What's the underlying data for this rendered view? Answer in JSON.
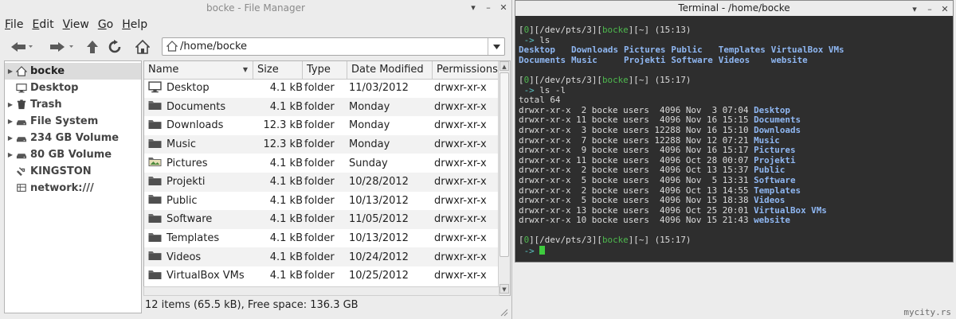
{
  "file_manager": {
    "title": "bocke - File Manager",
    "menu": [
      {
        "acc": "F",
        "rest": "ile"
      },
      {
        "acc": "E",
        "rest": "dit"
      },
      {
        "acc": "V",
        "rest": "iew"
      },
      {
        "acc": "G",
        "rest": "o"
      },
      {
        "acc": "H",
        "rest": "elp"
      }
    ],
    "toolbar_icons": [
      "back-arrow-icon",
      "forward-arrow-icon",
      "up-arrow-icon",
      "reload-icon",
      "home-icon"
    ],
    "address": "/home/bocke",
    "sidebar": [
      {
        "label": "bocke",
        "icon": "home-icon",
        "expander": true,
        "selected": true
      },
      {
        "label": "Desktop",
        "icon": "monitor-icon",
        "expander": false,
        "selected": false
      },
      {
        "label": "Trash",
        "icon": "trash-icon",
        "expander": true,
        "selected": false
      },
      {
        "label": "File System",
        "icon": "drive-icon",
        "expander": true,
        "selected": false
      },
      {
        "label": "234 GB Volume",
        "icon": "drive-icon",
        "expander": true,
        "selected": false
      },
      {
        "label": "80 GB Volume",
        "icon": "drive-icon",
        "expander": true,
        "selected": false
      },
      {
        "label": "KINGSTON",
        "icon": "usb-icon",
        "expander": false,
        "selected": false
      },
      {
        "label": "network:///",
        "icon": "network-icon",
        "expander": false,
        "selected": false
      }
    ],
    "columns": [
      "Name",
      "Size",
      "Type",
      "Date Modified",
      "Permissions"
    ],
    "files": [
      {
        "name": "Desktop",
        "size": "4.1 kB",
        "type": "folder",
        "date": "11/03/2012",
        "perm": "drwxr-xr-x",
        "icon": "monitor-icon"
      },
      {
        "name": "Documents",
        "size": "4.1 kB",
        "type": "folder",
        "date": "Monday",
        "perm": "drwxr-xr-x",
        "icon": "folder-icon"
      },
      {
        "name": "Downloads",
        "size": "12.3 kB",
        "type": "folder",
        "date": "Monday",
        "perm": "drwxr-xr-x",
        "icon": "folder-icon"
      },
      {
        "name": "Music",
        "size": "12.3 kB",
        "type": "folder",
        "date": "Monday",
        "perm": "drwxr-xr-x",
        "icon": "folder-icon"
      },
      {
        "name": "Pictures",
        "size": "4.1 kB",
        "type": "folder",
        "date": "Sunday",
        "perm": "drwxr-xr-x",
        "icon": "pictures-icon"
      },
      {
        "name": "Projekti",
        "size": "4.1 kB",
        "type": "folder",
        "date": "10/28/2012",
        "perm": "drwxr-xr-x",
        "icon": "folder-icon"
      },
      {
        "name": "Public",
        "size": "4.1 kB",
        "type": "folder",
        "date": "10/13/2012",
        "perm": "drwxr-xr-x",
        "icon": "folder-icon"
      },
      {
        "name": "Software",
        "size": "4.1 kB",
        "type": "folder",
        "date": "11/05/2012",
        "perm": "drwxr-xr-x",
        "icon": "folder-icon"
      },
      {
        "name": "Templates",
        "size": "4.1 kB",
        "type": "folder",
        "date": "10/13/2012",
        "perm": "drwxr-xr-x",
        "icon": "folder-icon"
      },
      {
        "name": "Videos",
        "size": "4.1 kB",
        "type": "folder",
        "date": "10/24/2012",
        "perm": "drwxr-xr-x",
        "icon": "folder-icon"
      },
      {
        "name": "VirtualBox VMs",
        "size": "4.1 kB",
        "type": "folder",
        "date": "10/25/2012",
        "perm": "drwxr-xr-x",
        "icon": "folder-icon"
      }
    ],
    "status": "12 items (65.5 kB), Free space: 136.3 GB"
  },
  "terminal": {
    "title": "Terminal - /home/bocke",
    "prompt": {
      "code": "0",
      "tty": "/dev/pts/3",
      "user": "bocke",
      "dir": "~",
      "arrow": "->"
    },
    "blocks": [
      {
        "time": "(15:13)",
        "cmd": "ls",
        "ls_rows": [
          [
            "Desktop",
            "Downloads",
            "Pictures",
            "Public",
            "Templates",
            "VirtualBox VMs"
          ],
          [
            "Documents",
            "Music",
            "Projekti",
            "Software",
            "Videos",
            "website"
          ]
        ]
      },
      {
        "time": "(15:17)",
        "cmd": "ls -l",
        "total": "total 64",
        "entries": [
          {
            "meta": "drwxr-xr-x  2 bocke users  4096 Nov  3 07:04",
            "name": "Desktop"
          },
          {
            "meta": "drwxr-xr-x 11 bocke users  4096 Nov 16 15:15",
            "name": "Documents"
          },
          {
            "meta": "drwxr-xr-x  3 bocke users 12288 Nov 16 15:10",
            "name": "Downloads"
          },
          {
            "meta": "drwxr-xr-x  7 bocke users 12288 Nov 12 07:21",
            "name": "Music"
          },
          {
            "meta": "drwxr-xr-x  9 bocke users  4096 Nov 16 15:17",
            "name": "Pictures"
          },
          {
            "meta": "drwxr-xr-x 11 bocke users  4096 Oct 28 00:07",
            "name": "Projekti"
          },
          {
            "meta": "drwxr-xr-x  2 bocke users  4096 Oct 13 15:37",
            "name": "Public"
          },
          {
            "meta": "drwxr-xr-x  5 bocke users  4096 Nov  5 13:31",
            "name": "Software"
          },
          {
            "meta": "drwxr-xr-x  2 bocke users  4096 Oct 13 14:55",
            "name": "Templates"
          },
          {
            "meta": "drwxr-xr-x  5 bocke users  4096 Nov 15 18:38",
            "name": "Videos"
          },
          {
            "meta": "drwxr-xr-x 13 bocke users  4096 Oct 25 20:01",
            "name": "VirtualBox VMs"
          },
          {
            "meta": "drwxr-xr-x 10 bocke users  4096 Nov 15 21:43",
            "name": "website"
          }
        ]
      },
      {
        "time": "(15:17)",
        "cmd": ""
      }
    ]
  },
  "watermark": "mycity.rs",
  "colors": {
    "terminal_bg": "#2e2e2e",
    "prompt_green": "#4eb84e",
    "dir_blue": "#8fb7f2",
    "cursor_green": "#3ecb3e"
  }
}
